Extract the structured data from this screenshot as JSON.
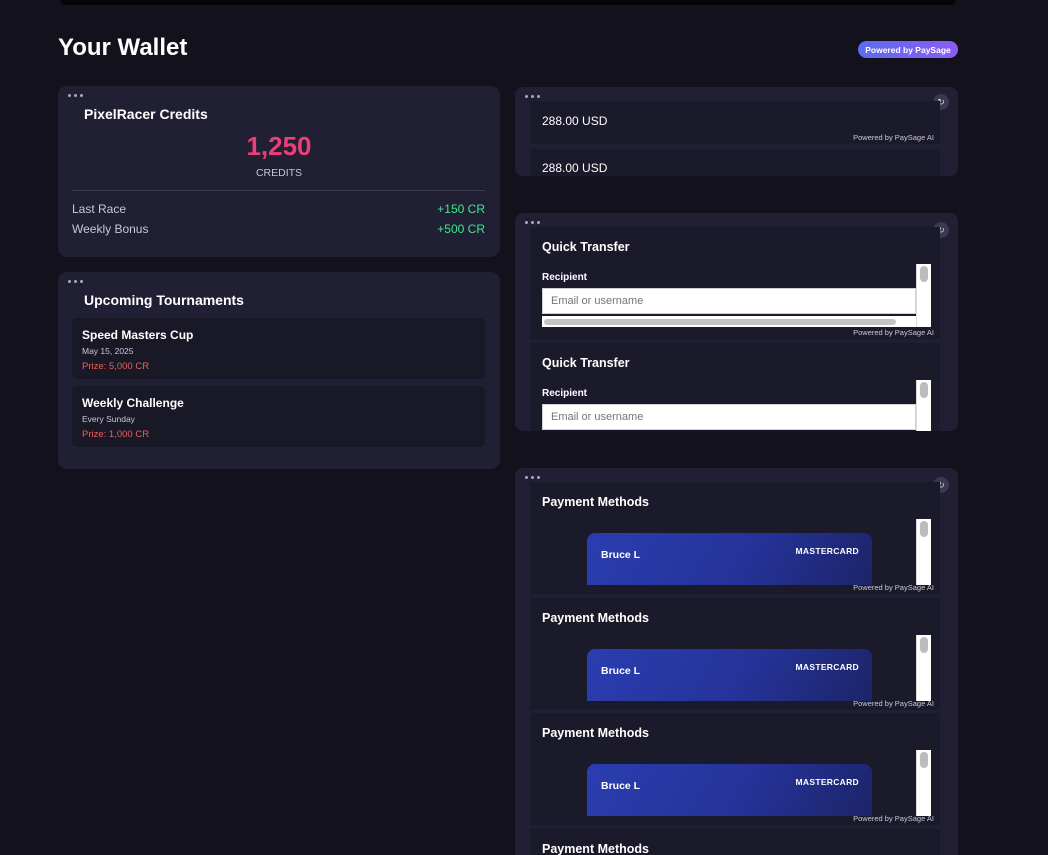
{
  "header": {
    "title": "Your Wallet",
    "powered_badge": "Powered by PaySage"
  },
  "credits": {
    "title": "PixelRacer Credits",
    "amount": "1,250",
    "unit": "CREDITS",
    "stats": [
      {
        "label": "Last Race",
        "value": "+150 CR"
      },
      {
        "label": "Weekly Bonus",
        "value": "+500 CR"
      }
    ]
  },
  "tournaments": {
    "title": "Upcoming Tournaments",
    "items": [
      {
        "name": "Speed Masters Cup",
        "date": "May 15, 2025",
        "prize": "Prize: 5,000 CR"
      },
      {
        "name": "Weekly Challenge",
        "date": "Every Sunday",
        "prize": "Prize: 1,000 CR"
      }
    ]
  },
  "balance_widget": {
    "balance": "288.00 USD",
    "powered": "Powered by PaySage AI"
  },
  "transfer_widget": {
    "title": "Quick Transfer",
    "recipient_label": "Recipient",
    "recipient_placeholder": "Email or username",
    "powered": "Powered by PaySage AI"
  },
  "payment_widget": {
    "title": "Payment Methods",
    "card_holder": "Bruce L",
    "card_brand": "MASTERCARD",
    "powered": "Powered by PaySage AI"
  },
  "icons": {
    "menu": "more-dots-icon",
    "refresh": "refresh-icon",
    "refresh_glyph": "↻"
  },
  "colors": {
    "credits_amount": "#ec3f77",
    "positive": "#3ee88c",
    "prize": "#ef5e5a",
    "badge_from": "#5b6cf0",
    "badge_to": "#8b5cf6"
  }
}
